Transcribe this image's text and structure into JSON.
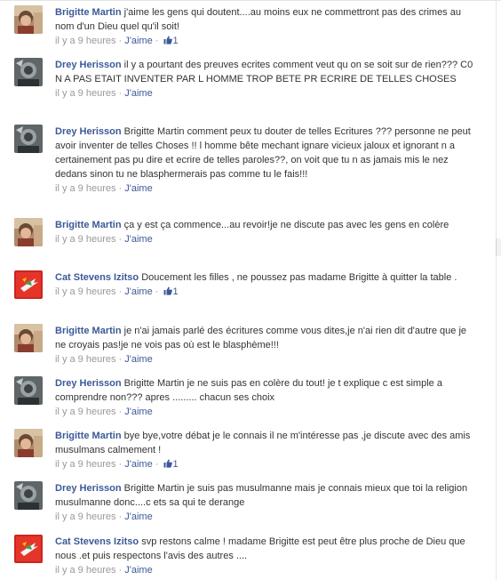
{
  "comments": [
    {
      "author": "Brigitte Martin",
      "avatar": "brigitte",
      "text": "j'aime les gens qui doutent....au moins eux ne commettront pas des crimes au nom d'un Dieu quel qu'il soit!",
      "time": "il y a 9 heures",
      "like_label": "J'aime",
      "likes": "1"
    },
    {
      "author": "Drey Herisson",
      "avatar": "drey",
      "text": "il y a pourtant des preuves ecrites comment veut qu on se soit sur de rien??? C0 N A PAS ETAIT INVENTER PAR L HOMME TROP BETE PR ECRIRE DE TELLES CHOSES",
      "time": "il y a 9 heures",
      "like_label": "J'aime",
      "likes": ""
    },
    {
      "author": "Drey Herisson",
      "avatar": "drey",
      "text": "Brigitte Martin comment peux tu douter de telles Ecritures ??? personne ne peut avoir inventer de telles Choses !! l homme bête mechant ignare vicieux jaloux et ignorant n a certainement pas pu dire et ecrire de telles paroles??, on voit que tu n as jamais mis le nez dedans sinon tu ne blasphermerais pas comme tu le fais!!!",
      "time": "il y a 9 heures",
      "like_label": "J'aime",
      "likes": ""
    },
    {
      "author": "Brigitte Martin",
      "avatar": "brigitte",
      "text": "ça y est ça commence...au revoir!je ne discute pas avec les gens en colère",
      "time": "il y a 9 heures",
      "like_label": "J'aime",
      "likes": ""
    },
    {
      "author": "Cat Stevens Izitso",
      "avatar": "cat",
      "text": "Doucement les filles , ne poussez pas madame Brigitte à quitter la table .",
      "time": "il y a 9 heures",
      "like_label": "J'aime",
      "likes": "1"
    },
    {
      "author": "Brigitte Martin",
      "avatar": "brigitte",
      "text": "je n'ai jamais parlé des écritures comme vous dites,je n'ai rien dit d'autre que je ne croyais pas!je ne vois pas où est le blasphème!!!",
      "time": "il y a 9 heures",
      "like_label": "J'aime",
      "likes": ""
    },
    {
      "author": "Drey Herisson",
      "avatar": "drey",
      "text": "Brigitte Martin je ne suis pas en colère du tout! je t explique c est simple a comprendre non??? apres ......... chacun ses choix",
      "time": "il y a 9 heures",
      "like_label": "J'aime",
      "likes": ""
    },
    {
      "author": "Brigitte Martin",
      "avatar": "brigitte",
      "text": "bye bye,votre débat je le connais il ne m'intéresse pas ,je discute avec des amis musulmans calmement !",
      "time": "il y a 9 heures",
      "like_label": "J'aime",
      "likes": "1"
    },
    {
      "author": "Drey Herisson",
      "avatar": "drey",
      "text": "Brigitte Martin je suis pas musulmanne mais je connais mieux que toi la religion musulmanne donc....c ets sa qui te derange",
      "time": "il y a 9 heures",
      "like_label": "J'aime",
      "likes": ""
    },
    {
      "author": "Cat Stevens Izitso",
      "avatar": "cat",
      "text": "svp restons calme ! madame Brigitte est peut être plus proche de Dieu que nous .et puis respectons l'avis des autres ....",
      "time": "il y a 9 heures",
      "like_label": "J'aime",
      "likes": ""
    }
  ],
  "colors": {
    "link": "#3b5998",
    "meta": "#999999",
    "text": "#333333"
  }
}
